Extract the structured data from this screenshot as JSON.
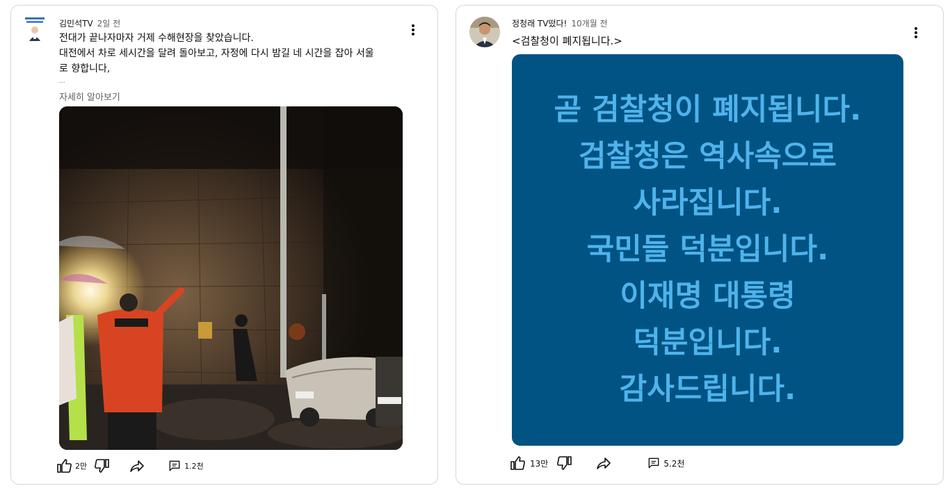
{
  "post1": {
    "author": "김민석TV",
    "time": "2일 전",
    "text_line1": "전대가 끝나자마자 거제 수해현장을 찾았습니다.",
    "text_line2": "대전에서 차로 세시간을 달려 돌아보고, 자정에 다시 밤길 네 시간을 잡아 서울",
    "text_line3": "로 향합니다,",
    "ellipsis": "...",
    "more_label": "자세히 알아보기",
    "likes": "2만",
    "comments": "1.2천",
    "photo_desc": "Night photo of flood damage scene with rescue workers in 119 uniforms near a wall and parked cars",
    "icons": [
      "like-icon",
      "dislike-icon",
      "share-icon",
      "comment-icon",
      "more-vert-icon"
    ]
  },
  "post2": {
    "author": "정청래 TV떴다!",
    "time": "10개월 전",
    "text": "<검찰청이 폐지됩니다.>",
    "image_lines": [
      "곧 검찰청이 폐지됩니다.",
      "검찰청은 역사속으로",
      "사라집니다.",
      "국민들 덕분입니다.",
      "이재명 대통령",
      "덕분입니다.",
      "감사드립니다."
    ],
    "image_bg": "#015383",
    "image_text_color": "#4fb3ec",
    "likes": "13만",
    "comments": "5.2천"
  }
}
